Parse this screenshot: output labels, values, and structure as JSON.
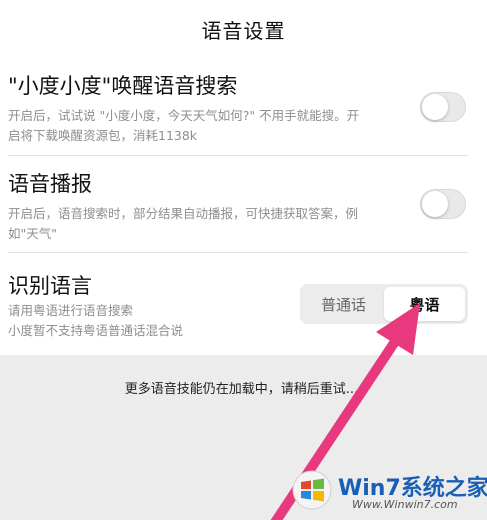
{
  "header": {
    "title": "语音设置"
  },
  "settings": [
    {
      "title": "\"小度小度\"唤醒语音搜索",
      "desc_line1": "开启后，试试说 \"小度小度，今天天气如何?\" 不用手就能搜。开",
      "desc_line2": "启将下载唤醒资源包，消耗1138k",
      "enabled": false
    },
    {
      "title": "语音播报",
      "desc_line1": "开启后，语音搜索时，部分结果自动播报，可快捷获取答案，例",
      "desc_line2": "如\"天气\"",
      "enabled": false
    }
  ],
  "language": {
    "title": "识别语言",
    "desc_line1": "请用粤语进行语音搜索",
    "desc_line2": "小度暂不支持粤语普通话混合说",
    "options": [
      "普通话",
      "粤语"
    ],
    "selected": "粤语"
  },
  "loading_text": "更多语音技能仍在加载中，请稍后重试....",
  "annotation": {
    "arrow_color": "#e8397f"
  },
  "watermark": {
    "brand": "Win7系统之家",
    "url": "Www.Winwin7.com"
  }
}
